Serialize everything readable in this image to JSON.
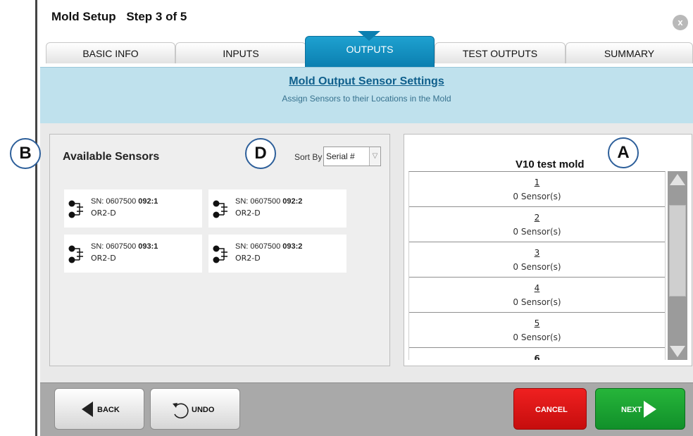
{
  "header": {
    "title": "Mold Setup",
    "step": "Step 3 of 5",
    "close_label": "x"
  },
  "tabs": [
    {
      "label": "BASIC INFO",
      "active": false
    },
    {
      "label": "INPUTS",
      "active": false
    },
    {
      "label": "OUTPUTS",
      "active": true
    },
    {
      "label": "TEST OUTPUTS",
      "active": false
    },
    {
      "label": "SUMMARY",
      "active": false
    }
  ],
  "banner": {
    "title": "Mold Output Sensor Settings",
    "subtitle": "Assign Sensors to their Locations in the Mold"
  },
  "available": {
    "title": "Available Sensors",
    "sort_label": "Sort By",
    "sort_value": "Serial #",
    "sensors": [
      {
        "sn_prefix": "SN: 0607500 ",
        "sn_bold": "092:1",
        "type": "OR2-D"
      },
      {
        "sn_prefix": "SN: 0607500 ",
        "sn_bold": "092:2",
        "type": "OR2-D"
      },
      {
        "sn_prefix": "SN: 0607500 ",
        "sn_bold": "093:1",
        "type": "OR2-D"
      },
      {
        "sn_prefix": "SN: 0607500 ",
        "sn_bold": "093:2",
        "type": "OR2-D"
      }
    ]
  },
  "mold": {
    "title": "V10 test mold",
    "locations": [
      {
        "num": "1",
        "count": "0 Sensor(s)"
      },
      {
        "num": "2",
        "count": "0 Sensor(s)"
      },
      {
        "num": "3",
        "count": "0 Sensor(s)"
      },
      {
        "num": "4",
        "count": "0 Sensor(s)"
      },
      {
        "num": "5",
        "count": "0 Sensor(s)"
      },
      {
        "num": "6",
        "count": ""
      }
    ]
  },
  "footer": {
    "back": "BACK",
    "undo": "UNDO",
    "cancel": "CANCEL",
    "next": "NEXT"
  },
  "callouts": {
    "a": "A",
    "b": "B",
    "d": "D"
  },
  "colors": {
    "accent": "#0b7fb0",
    "banner": "#bfe1ed",
    "cancel": "#d41414",
    "next": "#17a231"
  }
}
